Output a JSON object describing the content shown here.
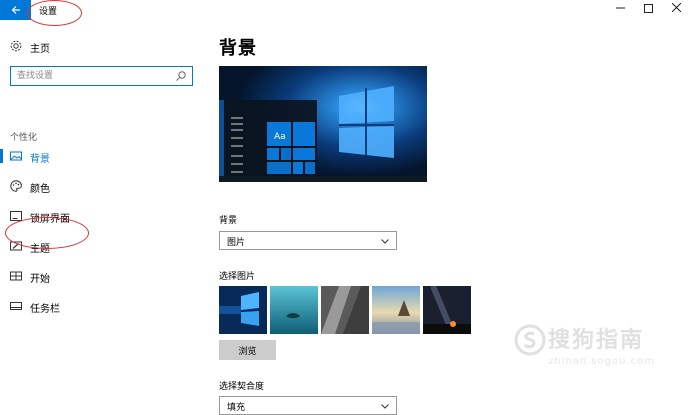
{
  "window": {
    "title": "设置",
    "back_icon": "arrow-left-icon",
    "accent": "#0078d7"
  },
  "sidebar": {
    "home_label": "主页",
    "search_placeholder": "查找设置",
    "section_title": "个性化",
    "items": [
      {
        "label": "背景",
        "icon": "picture-icon",
        "active": true
      },
      {
        "label": "颜色",
        "icon": "palette-icon",
        "active": false
      },
      {
        "label": "锁屏界面",
        "icon": "lock-screen-icon",
        "active": false
      },
      {
        "label": "主题",
        "icon": "theme-icon",
        "active": false
      },
      {
        "label": "开始",
        "icon": "start-icon",
        "active": false
      },
      {
        "label": "任务栏",
        "icon": "taskbar-icon",
        "active": false
      }
    ]
  },
  "main": {
    "title": "背景",
    "preview_tile_text": "Aa",
    "background_label": "背景",
    "background_value": "图片",
    "choose_picture_label": "选择图片",
    "browse_label": "浏览",
    "fit_label": "选择契合度",
    "fit_value": "填充"
  },
  "watermark": {
    "main": "搜狗指南",
    "sub": "zhinan.sogou.com"
  }
}
